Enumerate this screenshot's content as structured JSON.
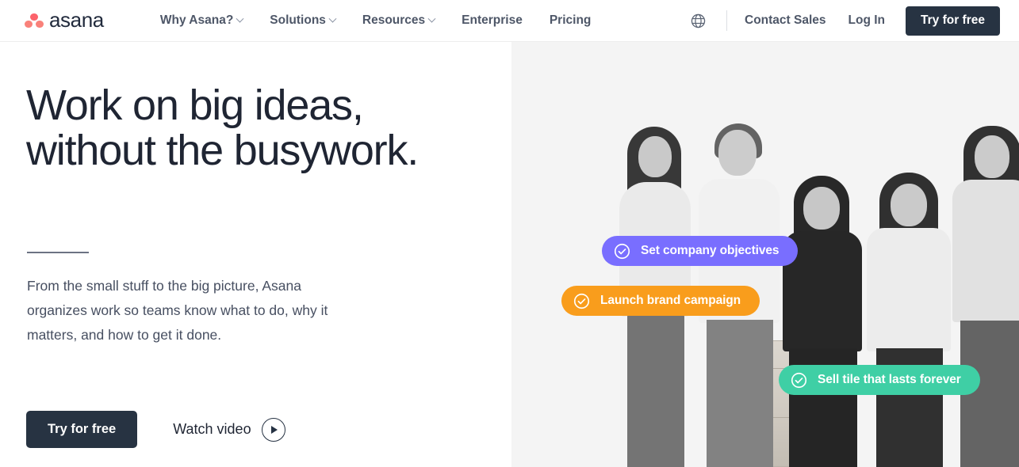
{
  "header": {
    "logo_text": "asana",
    "logo_icon": "asana-dots-logo",
    "nav": [
      {
        "label": "Why Asana?",
        "has_caret": true
      },
      {
        "label": "Solutions",
        "has_caret": true
      },
      {
        "label": "Resources",
        "has_caret": true
      },
      {
        "label": "Enterprise",
        "has_caret": false
      },
      {
        "label": "Pricing",
        "has_caret": false
      }
    ],
    "globe_icon": "globe-icon",
    "contact_sales": "Contact Sales",
    "log_in": "Log In",
    "try_free": "Try for free"
  },
  "hero": {
    "headline": "Work on big ideas,\nwithout the busywork.",
    "lede": "From the small stuff to the big picture, Asana organizes work so teams know what to do, why it matters, and how to get it done.",
    "primary_cta": "Try for free",
    "video_label": "Watch video",
    "play_icon": "play-icon"
  },
  "pills": [
    {
      "label": "Set company objectives",
      "color": "#796eff",
      "icon": "check-circle-icon"
    },
    {
      "label": "Launch brand campaign",
      "color": "#f99d1c",
      "icon": "check-circle-icon"
    },
    {
      "label": "Sell tile that lasts forever",
      "color": "#3fcfa5",
      "icon": "check-circle-icon"
    }
  ],
  "colors": {
    "brand_dark": "#273342",
    "logo_coral": "#fc636b",
    "text_body": "#474f61",
    "panel_bg": "#f4f4f4"
  }
}
